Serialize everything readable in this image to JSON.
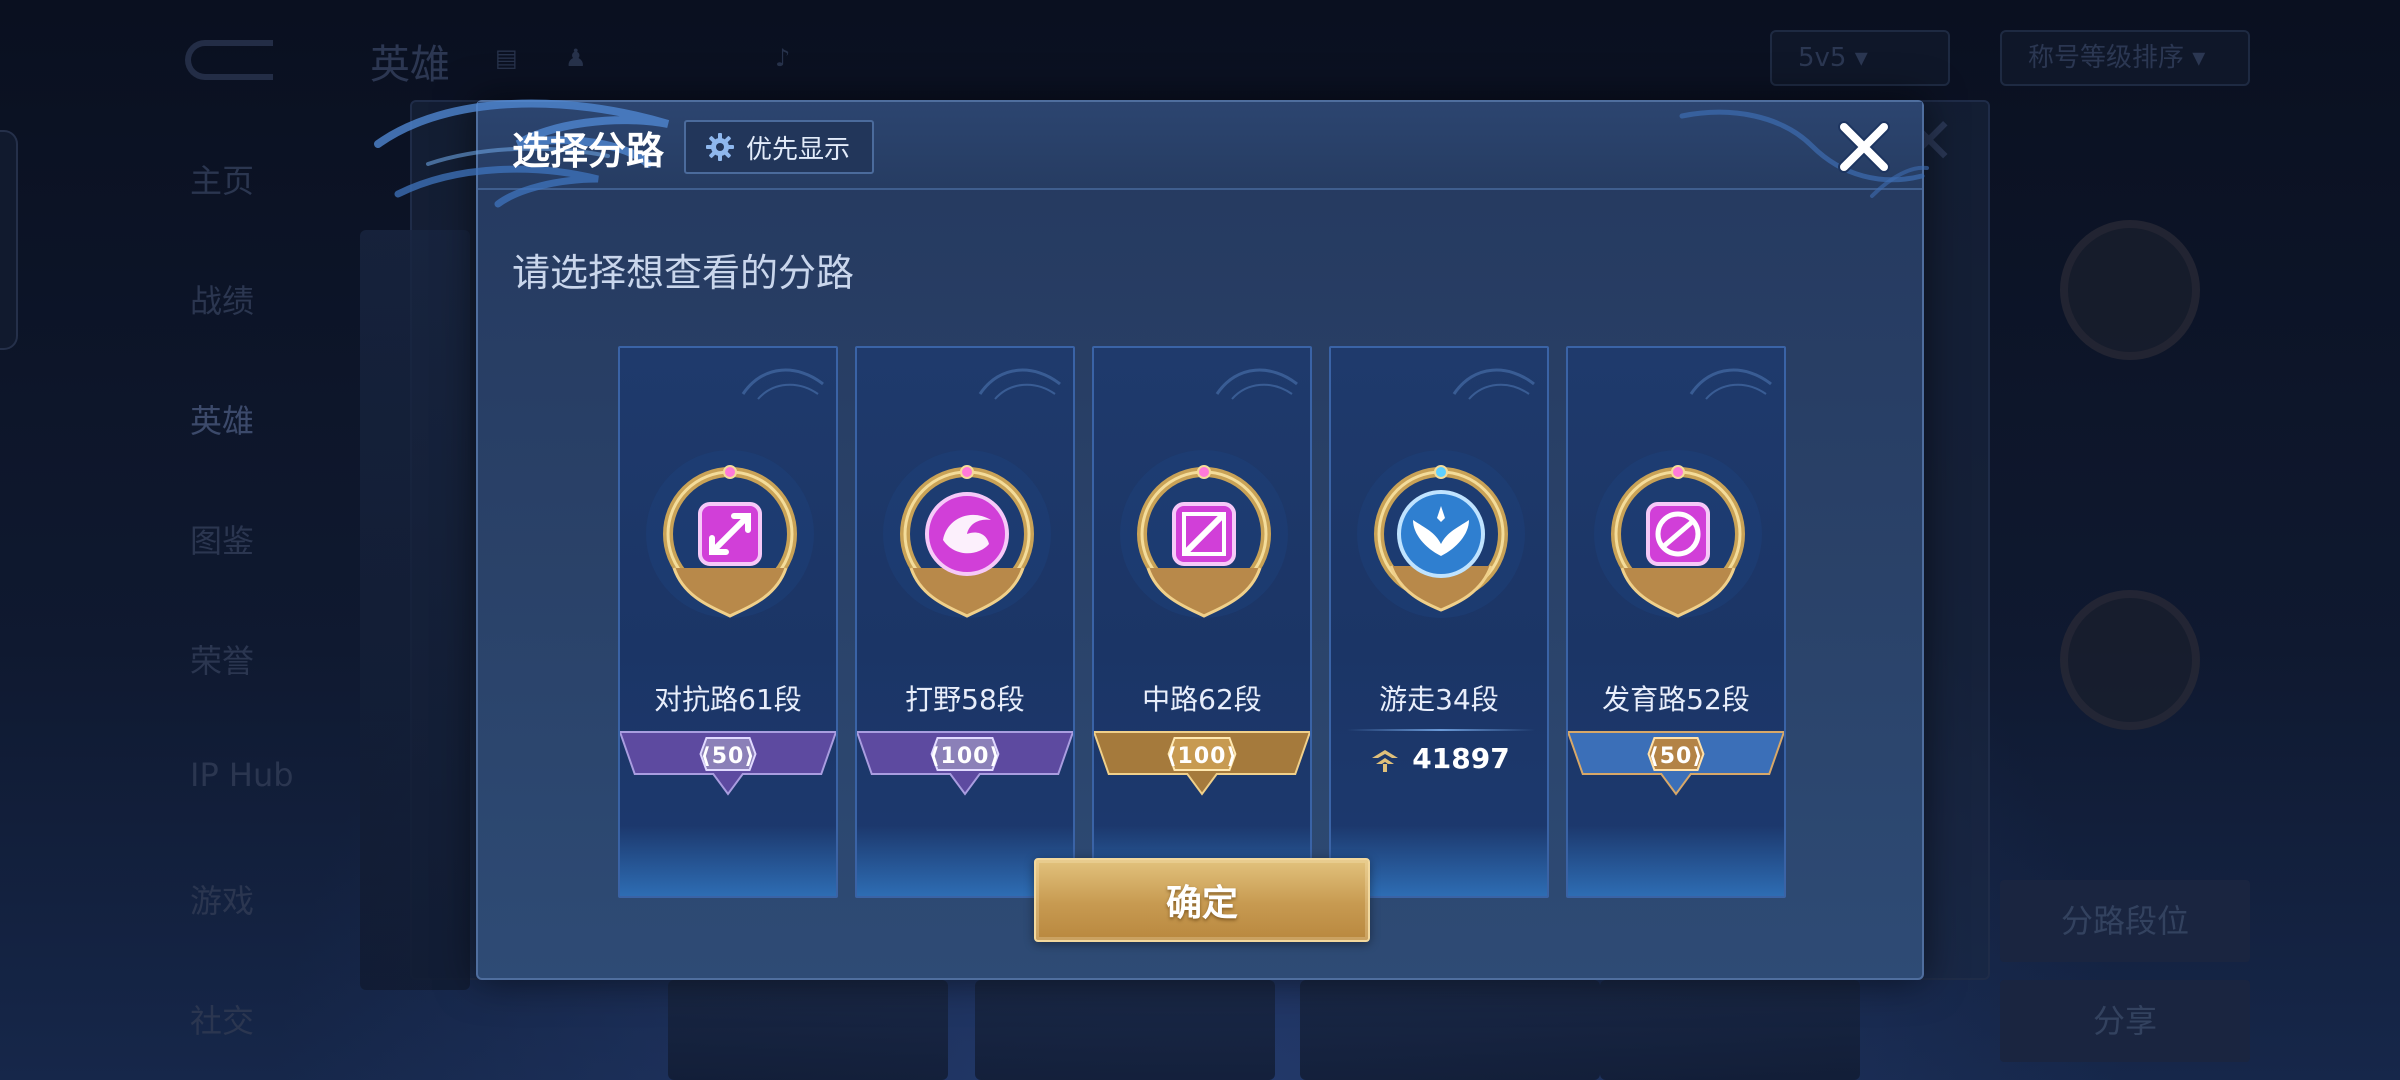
{
  "background": {
    "title": "英雄",
    "tools": [
      "",
      ""
    ],
    "mode_select": "5v5",
    "sort_select": "称号等级排序",
    "sidebar": [
      "主页",
      "战绩",
      "英雄",
      "图鉴",
      "荣誉",
      "IP Hub",
      "游戏",
      "社交"
    ],
    "right_buttons": [
      "分路段位",
      "分享"
    ]
  },
  "modal": {
    "title": "选择分路",
    "priority_label": "优先显示",
    "subtitle": "请选择想查看的分路",
    "confirm_label": "确定"
  },
  "lanes": [
    {
      "label": "对抗路61段",
      "rank_value": "50",
      "banner": "purple",
      "symbol": "clash-lane"
    },
    {
      "label": "打野58段",
      "rank_value": "100",
      "banner": "purple",
      "symbol": "jungle"
    },
    {
      "label": "中路62段",
      "rank_value": "100",
      "banner": "gold",
      "symbol": "mid-lane"
    },
    {
      "label": "游走34段",
      "score_value": "41897",
      "banner": "none",
      "symbol": "roam"
    },
    {
      "label": "发育路52段",
      "rank_value": "50",
      "banner": "blue",
      "symbol": "farm-lane"
    }
  ],
  "colors": {
    "accent_gold": "#c79a51",
    "medal_pink": "#d13fd8",
    "medal_blue": "#2f7fd0",
    "banner_purple": "#5d4aa0",
    "banner_gold": "#a57a3c",
    "banner_blue": "#3b6fb8"
  }
}
